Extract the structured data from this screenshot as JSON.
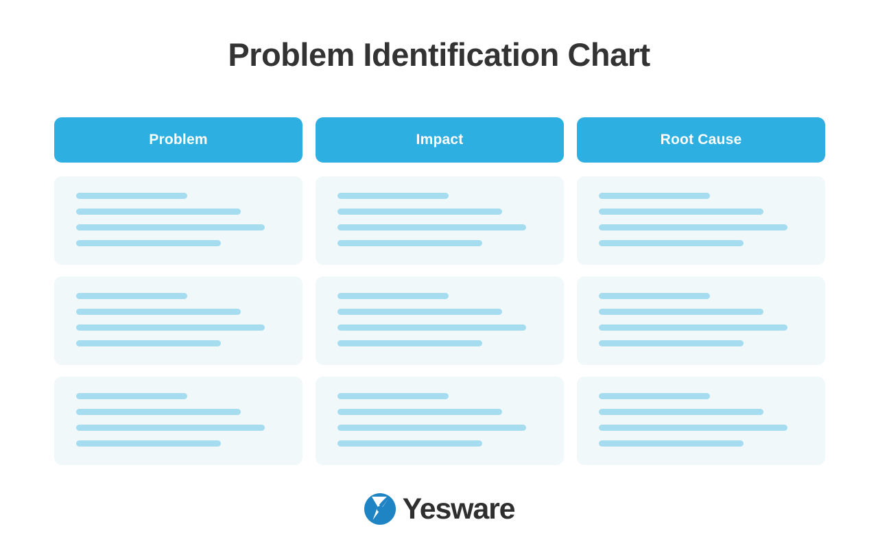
{
  "page": {
    "title": "Problem Identification Chart",
    "background_color": "#ffffff",
    "title_color": "#333333"
  },
  "colors": {
    "header_blue": "#2eafe2",
    "card_background": "#f0f8fa",
    "placeholder_bar": "#a5dcef",
    "logo_blue": "#1f84c4",
    "logo_text": "#2f2f2f"
  },
  "table": {
    "columns": [
      {
        "label": "Problem"
      },
      {
        "label": "Impact"
      },
      {
        "label": "Root Cause"
      }
    ],
    "rows": [
      {
        "cells": [
          {
            "bars": [
              162,
              240,
              275,
              211
            ]
          },
          {
            "bars": [
              162,
              240,
              275,
              211
            ]
          },
          {
            "bars": [
              162,
              240,
              275,
              211
            ]
          }
        ]
      },
      {
        "cells": [
          {
            "bars": [
              162,
              240,
              275,
              211
            ]
          },
          {
            "bars": [
              162,
              240,
              275,
              211
            ]
          },
          {
            "bars": [
              162,
              240,
              275,
              211
            ]
          }
        ]
      },
      {
        "cells": [
          {
            "bars": [
              162,
              240,
              275,
              211
            ]
          },
          {
            "bars": [
              162,
              240,
              275,
              211
            ]
          },
          {
            "bars": [
              162,
              240,
              275,
              211
            ]
          }
        ]
      }
    ]
  },
  "footer": {
    "logo_icon": "yesware-logo-icon",
    "brand_name": "Yesware"
  }
}
